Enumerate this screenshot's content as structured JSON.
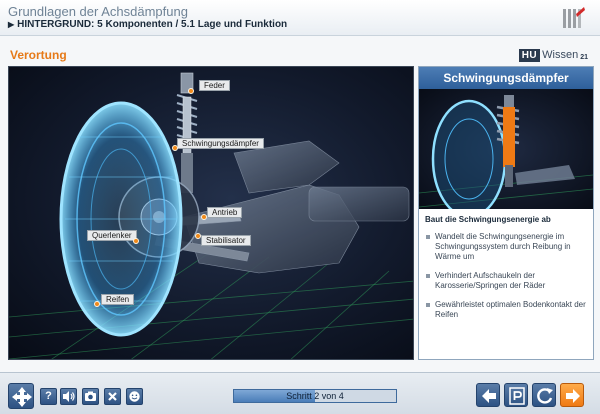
{
  "header": {
    "course_title": "Grundlagen der Achsdämpfung",
    "breadcrumb": "HINTERGRUND: 5 Komponenten / 5.1 Lage und Funktion"
  },
  "section": {
    "title": "Verortung",
    "brand_hu": "HU",
    "brand_wissen": "Wissen",
    "brand_num": "21"
  },
  "main_image": {
    "labels": {
      "feder": "Feder",
      "schwingungsdaempfer": "Schwingungsdämpfer",
      "antrieb": "Antrieb",
      "querlenker": "Querlenker",
      "stabilisator": "Stabilisator",
      "reifen": "Reifen"
    }
  },
  "side_panel": {
    "title": "Schwingungsdämpfer",
    "subtitle": "Baut die Schwingungsenergie ab",
    "bullets": [
      "Wandelt die Schwingungsenergie im Schwingungssystem durch Reibung in Wärme um",
      "Verhindert Aufschaukeln der Karosserie/Springen der Räder",
      "Gewährleistet optimalen Bodenkontakt der Reifen"
    ]
  },
  "toolbar": {
    "help_label": "?",
    "progress_label": "Schritt 2 von 4",
    "progress_fraction": 0.5,
    "accent_blue": "#2d5283",
    "accent_orange": "#ef7a14"
  }
}
